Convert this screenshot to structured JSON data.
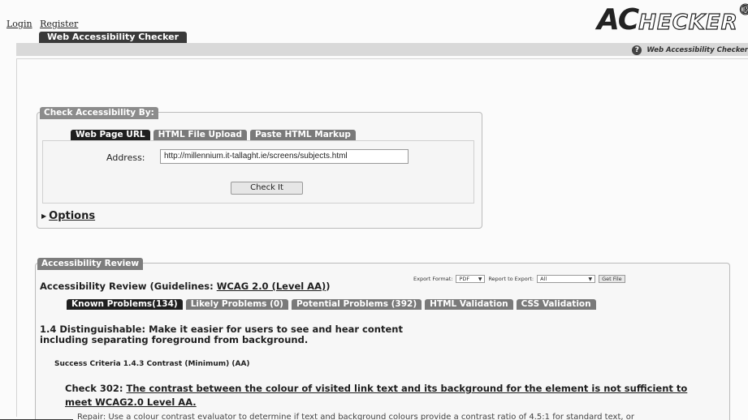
{
  "header": {
    "login": "Login",
    "register": "Register",
    "brand_tab": "Web Accessibility Checker",
    "logo_ac": "AC",
    "logo_rest": "HECKER",
    "logo_reg": "®",
    "help_text": "Web Accessibility Checker",
    "help_icon": "?"
  },
  "check_panel": {
    "title": "Check Accessibility By:",
    "tabs": [
      "Web Page URL",
      "HTML File Upload",
      "Paste HTML Markup"
    ],
    "active_tab": 0,
    "address_label": "Address:",
    "address_value": "http://millennium.it-tallaght.ie/screens/subjects.html",
    "check_button": "Check It",
    "options_label": "Options"
  },
  "review_panel": {
    "title": "Accessibility Review",
    "heading_prefix": "Accessibility Review (Guidelines: ",
    "heading_link": "WCAG 2.0 (Level AA)",
    "heading_suffix": ")",
    "export_format_label": "Export Format:",
    "export_format_value": "PDF",
    "report_label": "Report to Export:",
    "report_value": "All",
    "get_file": "Get File",
    "tabs": [
      "Known Problems(134)",
      "Likely Problems (0)",
      "Potential Problems (392)",
      "HTML Validation",
      "CSS Validation"
    ],
    "active_tab": 0,
    "section_title": "1.4 Distinguishable: Make it easier for users to see and hear content including separating foreground from background.",
    "criteria": "Success Criteria 1.4.3 Contrast (Minimum) (AA)",
    "check_label": "Check 302:",
    "check_text": "The contrast between the colour of visited link text and its background for the element is not sufficient to meet WCAG2.0 Level AA.",
    "cut_off_line": "Repair: Use a colour contrast evaluator to determine if text and background colours provide a contrast ratio of 4.5:1 for standard text, or"
  }
}
